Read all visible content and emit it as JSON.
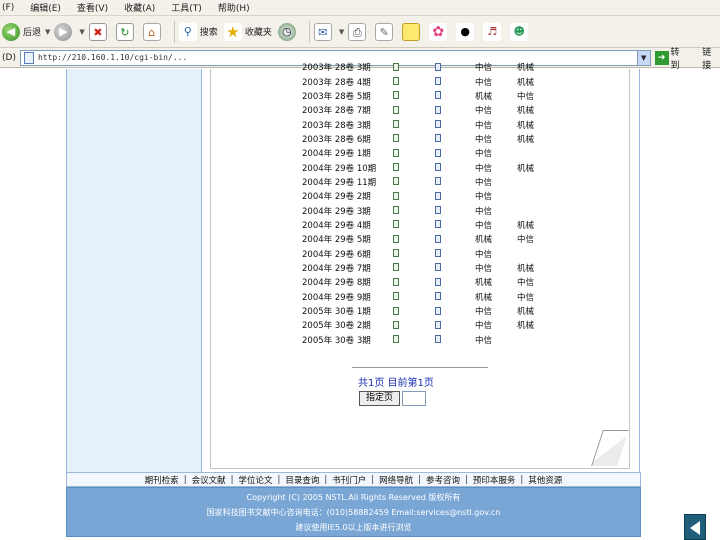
{
  "menu": [
    "(F)",
    "编辑(E)",
    "查看(V)",
    "收藏(A)",
    "工具(T)",
    "帮助(H)"
  ],
  "toolbar": {
    "back_label": "后退",
    "search_label": "搜索",
    "favorites_label": "收藏夹"
  },
  "address": {
    "label": "(D)",
    "url": "http://210.160.1.10/cgi-bin/..."
  },
  "go_label": "转到",
  "links_label": "链接",
  "issues": [
    {
      "issue": "2003年 28卷 3期",
      "s1": "中信",
      "s2": "机械"
    },
    {
      "issue": "2003年 28卷 4期",
      "s1": "中信",
      "s2": "机械"
    },
    {
      "issue": "2003年 28卷 5期",
      "s1": "机械",
      "s2": "中信"
    },
    {
      "issue": "2003年 28卷 7期",
      "s1": "中信",
      "s2": "机械"
    },
    {
      "issue": "2003年 28卷 3期",
      "s1": "中信",
      "s2": "机械"
    },
    {
      "issue": "2003年 28卷 6期",
      "s1": "中信",
      "s2": "机械"
    },
    {
      "issue": "2004年 29卷 1期",
      "s1": "中信",
      "s2": ""
    },
    {
      "issue": "2004年 29卷 10期",
      "s1": "中信",
      "s2": "机械"
    },
    {
      "issue": "2004年 29卷 11期",
      "s1": "中信",
      "s2": ""
    },
    {
      "issue": "2004年 29卷 2期",
      "s1": "中信",
      "s2": ""
    },
    {
      "issue": "2004年 29卷 3期",
      "s1": "中信",
      "s2": ""
    },
    {
      "issue": "2004年 29卷 4期",
      "s1": "中信",
      "s2": "机械"
    },
    {
      "issue": "2004年 29卷 5期",
      "s1": "机械",
      "s2": "中信"
    },
    {
      "issue": "2004年 29卷 6期",
      "s1": "中信",
      "s2": ""
    },
    {
      "issue": "2004年 29卷 7期",
      "s1": "中信",
      "s2": "机械"
    },
    {
      "issue": "2004年 29卷 8期",
      "s1": "机械",
      "s2": "中信"
    },
    {
      "issue": "2004年 29卷 9期",
      "s1": "机械",
      "s2": "中信"
    },
    {
      "issue": "2005年 30卷 1期",
      "s1": "中信",
      "s2": "机械"
    },
    {
      "issue": "2005年 30卷 2期",
      "s1": "中信",
      "s2": "机械"
    },
    {
      "issue": "2005年 30卷 3期",
      "s1": "中信",
      "s2": ""
    }
  ],
  "pager": {
    "text": "共1页 目前第1页",
    "goto_label": "指定页"
  },
  "footer": {
    "nav": [
      "期刊检索",
      "会议文献",
      "学位论文",
      "目录查询",
      "书刊门户",
      "网络导航",
      "参考咨询",
      "预印本服务",
      "其他资源"
    ],
    "copyright": "Copyright (C) 2005 NSTL.All Rights Reserved 版权所有",
    "contact": "国家科技图书文献中心咨询电话：(010)58882459 Email:services@nstl.gov.cn",
    "browser_note": "建议使用IE5.0以上版本进行浏览"
  }
}
